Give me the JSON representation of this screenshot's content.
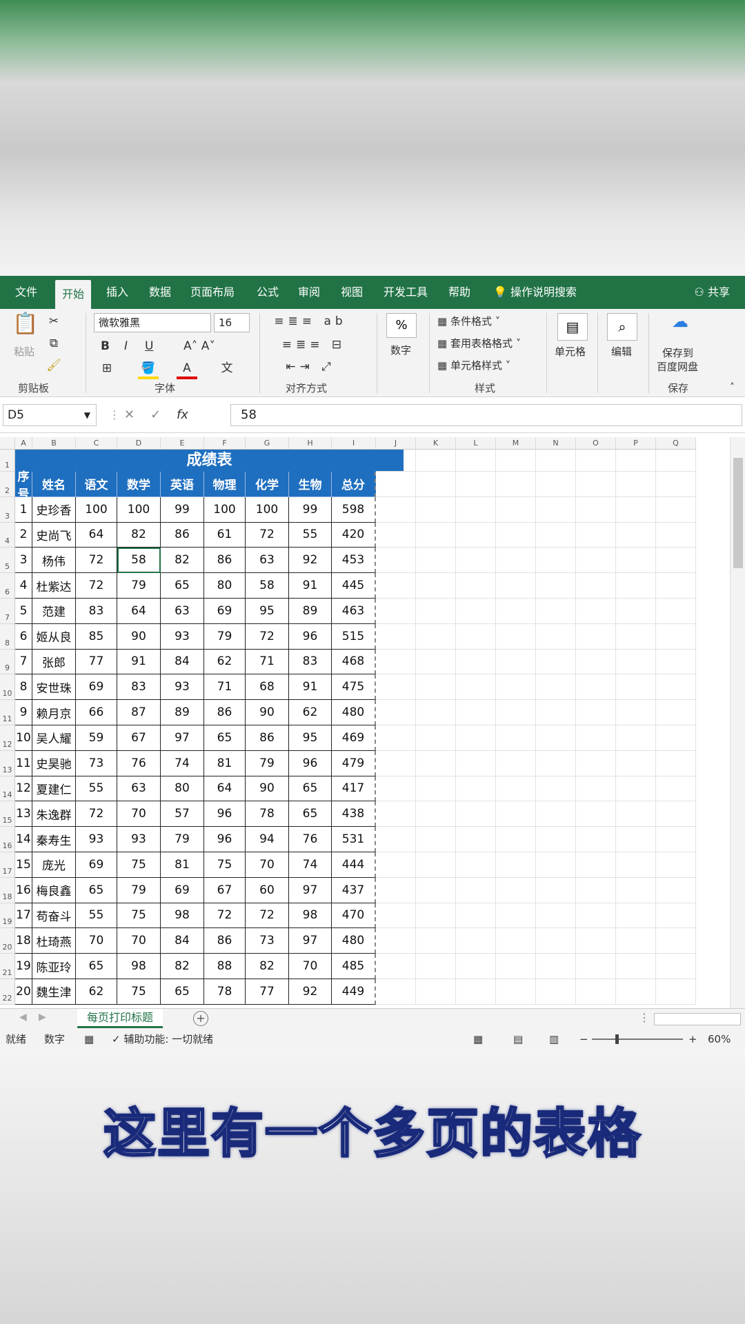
{
  "ribbon": {
    "tabs": [
      "文件",
      "开始",
      "插入",
      "数据",
      "页面布局",
      "公式",
      "审阅",
      "视图",
      "开发工具",
      "帮助"
    ],
    "active_tab": "开始",
    "tell_me": "操作说明搜索",
    "share": "共享",
    "clipboard": {
      "paste": "粘贴",
      "group": "剪贴板"
    },
    "font": {
      "name": "微软雅黑",
      "size": "16",
      "group": "字体",
      "bold": "B",
      "italic": "I",
      "underline": "U"
    },
    "alignment": {
      "group": "对齐方式"
    },
    "number": {
      "label": "数字",
      "symbol": "%"
    },
    "styles": {
      "conditional": "条件格式",
      "table_format": "套用表格格式",
      "cell_styles": "单元格样式",
      "group": "样式"
    },
    "cells": {
      "label": "单元格"
    },
    "editing": {
      "label": "编辑"
    },
    "save": {
      "line1": "保存到",
      "line2": "百度网盘",
      "group": "保存"
    }
  },
  "formula_bar": {
    "name_box": "D5",
    "value": "58",
    "fx": "fx"
  },
  "columns": [
    "A",
    "B",
    "C",
    "D",
    "E",
    "F",
    "G",
    "H",
    "I",
    "J",
    "K",
    "L",
    "M",
    "N",
    "O",
    "P",
    "Q"
  ],
  "table": {
    "title": "成绩表",
    "headers": [
      "序号",
      "姓名",
      "语文",
      "数学",
      "英语",
      "物理",
      "化学",
      "生物",
      "总分"
    ],
    "rows": [
      [
        "1",
        "史珍香",
        "100",
        "100",
        "99",
        "100",
        "100",
        "99",
        "598"
      ],
      [
        "2",
        "史尚飞",
        "64",
        "82",
        "86",
        "61",
        "72",
        "55",
        "420"
      ],
      [
        "3",
        "杨伟",
        "72",
        "58",
        "82",
        "86",
        "63",
        "92",
        "453"
      ],
      [
        "4",
        "杜紫达",
        "72",
        "79",
        "65",
        "80",
        "58",
        "91",
        "445"
      ],
      [
        "5",
        "范建",
        "83",
        "64",
        "63",
        "69",
        "95",
        "89",
        "463"
      ],
      [
        "6",
        "姬从良",
        "85",
        "90",
        "93",
        "79",
        "72",
        "96",
        "515"
      ],
      [
        "7",
        "张郎",
        "77",
        "91",
        "84",
        "62",
        "71",
        "83",
        "468"
      ],
      [
        "8",
        "安世珠",
        "69",
        "83",
        "93",
        "71",
        "68",
        "91",
        "475"
      ],
      [
        "9",
        "赖月京",
        "66",
        "87",
        "89",
        "86",
        "90",
        "62",
        "480"
      ],
      [
        "10",
        "吴人耀",
        "59",
        "67",
        "97",
        "65",
        "86",
        "95",
        "469"
      ],
      [
        "11",
        "史昊驰",
        "73",
        "76",
        "74",
        "81",
        "79",
        "96",
        "479"
      ],
      [
        "12",
        "夏建仁",
        "55",
        "63",
        "80",
        "64",
        "90",
        "65",
        "417"
      ],
      [
        "13",
        "朱逸群",
        "72",
        "70",
        "57",
        "96",
        "78",
        "65",
        "438"
      ],
      [
        "14",
        "秦寿生",
        "93",
        "93",
        "79",
        "96",
        "94",
        "76",
        "531"
      ],
      [
        "15",
        "庞光",
        "69",
        "75",
        "81",
        "75",
        "70",
        "74",
        "444"
      ],
      [
        "16",
        "梅良鑫",
        "65",
        "79",
        "69",
        "67",
        "60",
        "97",
        "437"
      ],
      [
        "17",
        "苟奋斗",
        "55",
        "75",
        "98",
        "72",
        "72",
        "98",
        "470"
      ],
      [
        "18",
        "杜琦燕",
        "70",
        "70",
        "84",
        "86",
        "73",
        "97",
        "480"
      ],
      [
        "19",
        "陈亚玲",
        "65",
        "98",
        "82",
        "88",
        "82",
        "70",
        "485"
      ],
      [
        "20",
        "魏生津",
        "62",
        "75",
        "65",
        "78",
        "77",
        "92",
        "449"
      ]
    ]
  },
  "row_numbers": [
    "1",
    "2",
    "3",
    "4",
    "5",
    "6",
    "7",
    "8",
    "9",
    "10",
    "11",
    "12",
    "13",
    "14",
    "15",
    "16",
    "17",
    "18",
    "19",
    "20",
    "21",
    "22"
  ],
  "sheet_tab": "每页打印标题",
  "status": {
    "ready": "就绪",
    "mode": "数字",
    "accessibility": "辅助功能: 一切就绪",
    "zoom": "60%"
  },
  "subtitle": "这里有一个多页的表格",
  "colors": {
    "excel_green": "#217346",
    "header_blue": "#1f6fc0"
  }
}
